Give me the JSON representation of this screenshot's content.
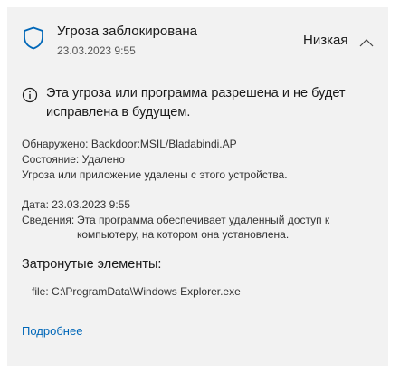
{
  "alert": {
    "title": "Угроза заблокирована",
    "timestamp": "23.03.2023 9:55",
    "severity": "Низкая",
    "info_message": "Эта угроза или программа разрешена и не будет исправлена в будущем.",
    "details": {
      "detected_label": "Обнаружено:",
      "detected_value": "Backdoor:MSIL/Bladabindi.AP",
      "status_label": "Состояние:",
      "status_value": "Удалено",
      "status_note": "Угроза или приложение удалены с этого устройства.",
      "date_label": "Дата:",
      "date_value": "23.03.2023 9:55",
      "info_label": "Сведения:",
      "info_value": "Эта программа обеспечивает удаленный доступ к компьютеру, на котором она установлена."
    },
    "affected_title": "Затронутые элементы:",
    "affected_items": [
      {
        "type": "file:",
        "path": "C:\\ProgramData\\Windows Explorer.exe"
      }
    ],
    "more_link": "Подробнее"
  },
  "colors": {
    "card_background": "#f2f2f2",
    "shield_blue": "#0067b8",
    "link_blue": "#0067b8"
  },
  "icons": {
    "shield": "shield-icon",
    "chevron": "chevron-up-icon",
    "info": "info-icon"
  }
}
